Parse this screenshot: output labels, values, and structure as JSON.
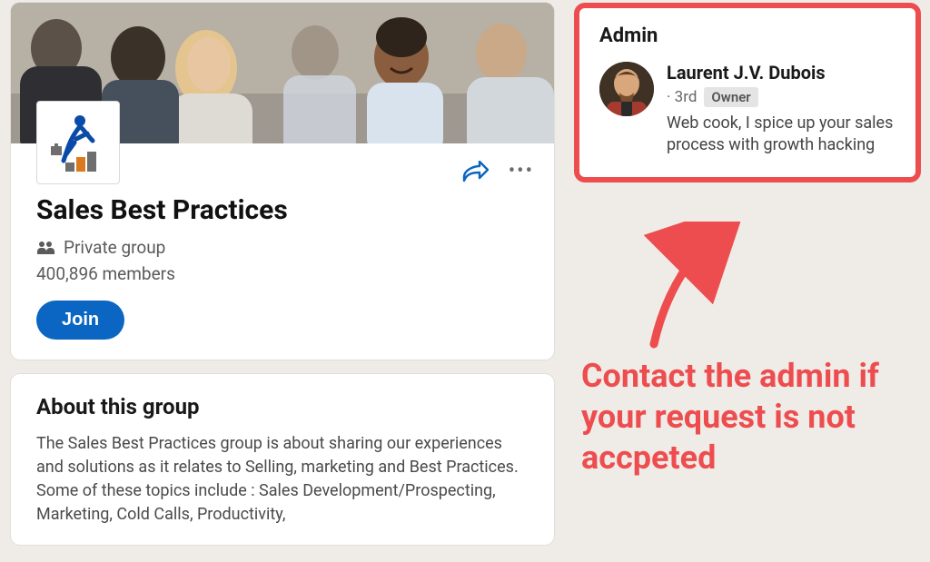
{
  "group": {
    "title": "Sales Best Practices",
    "privacy_label": "Private group",
    "members_label": "400,896 members",
    "join_label": "Join"
  },
  "about": {
    "heading": "About this group",
    "body": "The Sales Best Practices group is about sharing our experiences and solutions as it relates to Selling, marketing and Best Practices. Some of these topics include : Sales Development/Prospecting,  Marketing, Cold Calls, Productivity,"
  },
  "admin": {
    "heading": "Admin",
    "name": "Laurent J.V. Dubois",
    "degree": "· 3rd",
    "owner_badge": "Owner",
    "bio": "Web cook, I spice up your sales process with growth hacking"
  },
  "annotation": {
    "text": "Contact the admin if your request is not accpeted"
  },
  "colors": {
    "accent": "#0a66c2",
    "highlight": "#ee4d4f"
  }
}
